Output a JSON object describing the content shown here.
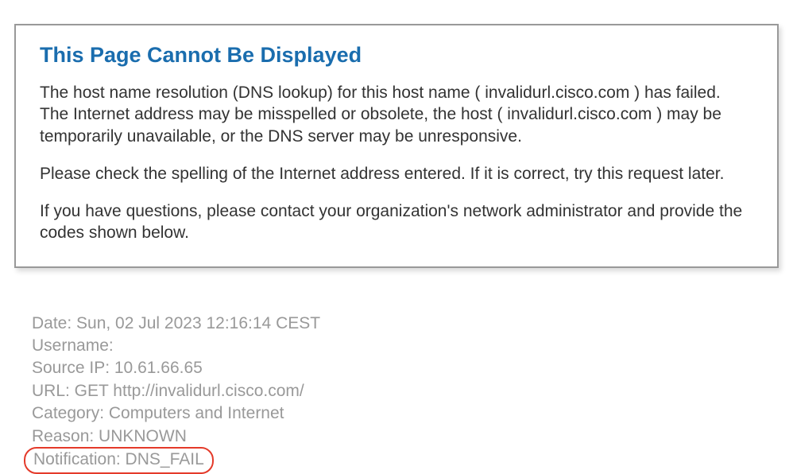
{
  "error": {
    "title": "This Page Cannot Be Displayed",
    "paragraph1": "The host name resolution (DNS lookup) for this host name ( invalidurl.cisco.com ) has failed. The Internet address may be misspelled or obsolete, the host ( invalidurl.cisco.com ) may be temporarily unavailable, or the DNS server may be unresponsive.",
    "paragraph2": "Please check the spelling of the Internet address entered. If it is correct, try this request later.",
    "paragraph3": "If you have questions, please contact your organization's network administrator and provide the codes shown below."
  },
  "details": {
    "date": "Date: Sun, 02 Jul 2023 12:16:14 CEST",
    "username": "Username:",
    "source_ip": "Source IP: 10.61.66.65",
    "url": "URL: GET http://invalidurl.cisco.com/",
    "category": "Category: Computers and Internet",
    "reason": "Reason: UNKNOWN",
    "notification": "Notification: DNS_FAIL"
  }
}
